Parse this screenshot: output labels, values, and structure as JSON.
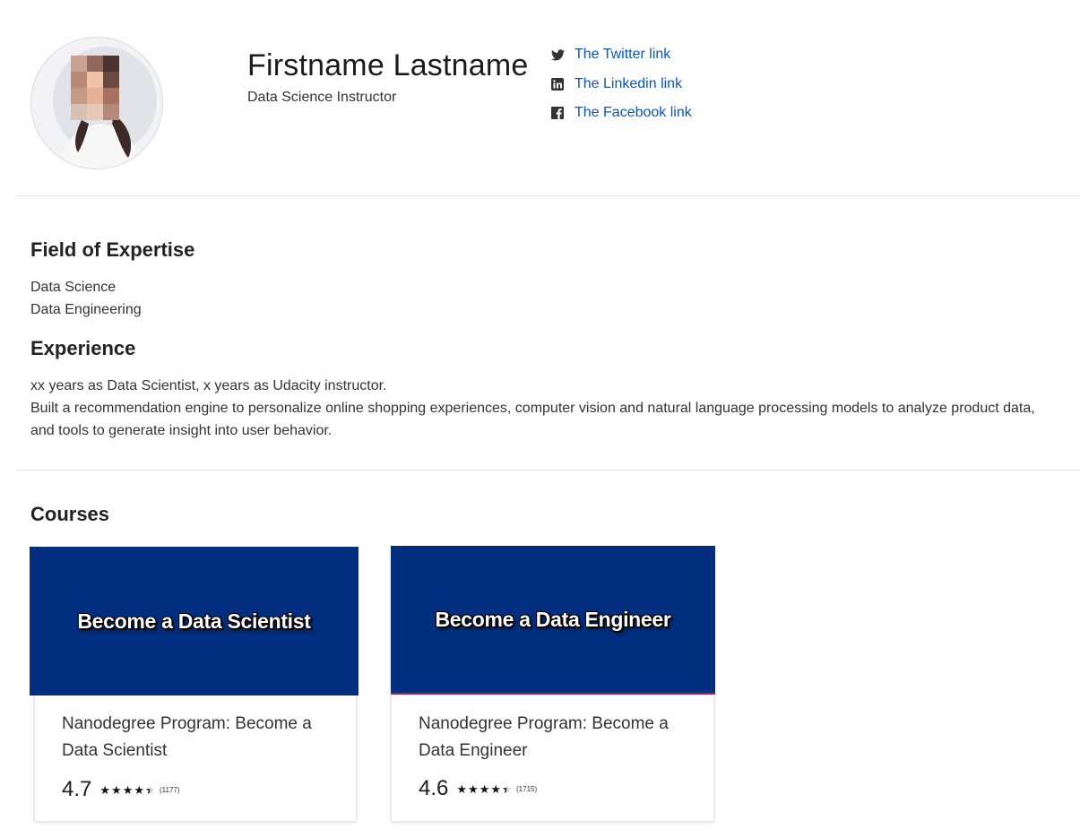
{
  "profile": {
    "name": "Firstname Lastname",
    "role": "Data Science Instructor"
  },
  "social": [
    {
      "label": "The Twitter link",
      "icon": "twitter-icon"
    },
    {
      "label": "The Linkedin link",
      "icon": "linkedin-icon"
    },
    {
      "label": "The Facebook link",
      "icon": "facebook-icon"
    }
  ],
  "expertise": {
    "title": "Field of Expertise",
    "items": [
      "Data Science",
      "Data Engineering"
    ]
  },
  "experience": {
    "title": "Experience",
    "lines": [
      "xx years as Data Scientist, x years as Udacity instructor.",
      "Built a recommendation engine to personalize online shopping experiences, computer vision and natural language processing models to analyze product data,",
      "and tools to generate insight into user behavior."
    ]
  },
  "courses": {
    "title": "Courses",
    "items": [
      {
        "banner": "Become a Data Scientist",
        "title": "Nanodegree Program: Become a Data Scientist",
        "rating": "4.7",
        "rating_value": 4.7,
        "count": "(1177)"
      },
      {
        "banner": "Become a Data Engineer",
        "title": "Nanodegree Program: Become a Data Engineer",
        "rating": "4.6",
        "rating_value": 4.6,
        "count": "(1715)"
      }
    ]
  },
  "colors": {
    "link": "#0a56c2",
    "banner": "#022e7f",
    "divider": "#e4e4e4"
  }
}
